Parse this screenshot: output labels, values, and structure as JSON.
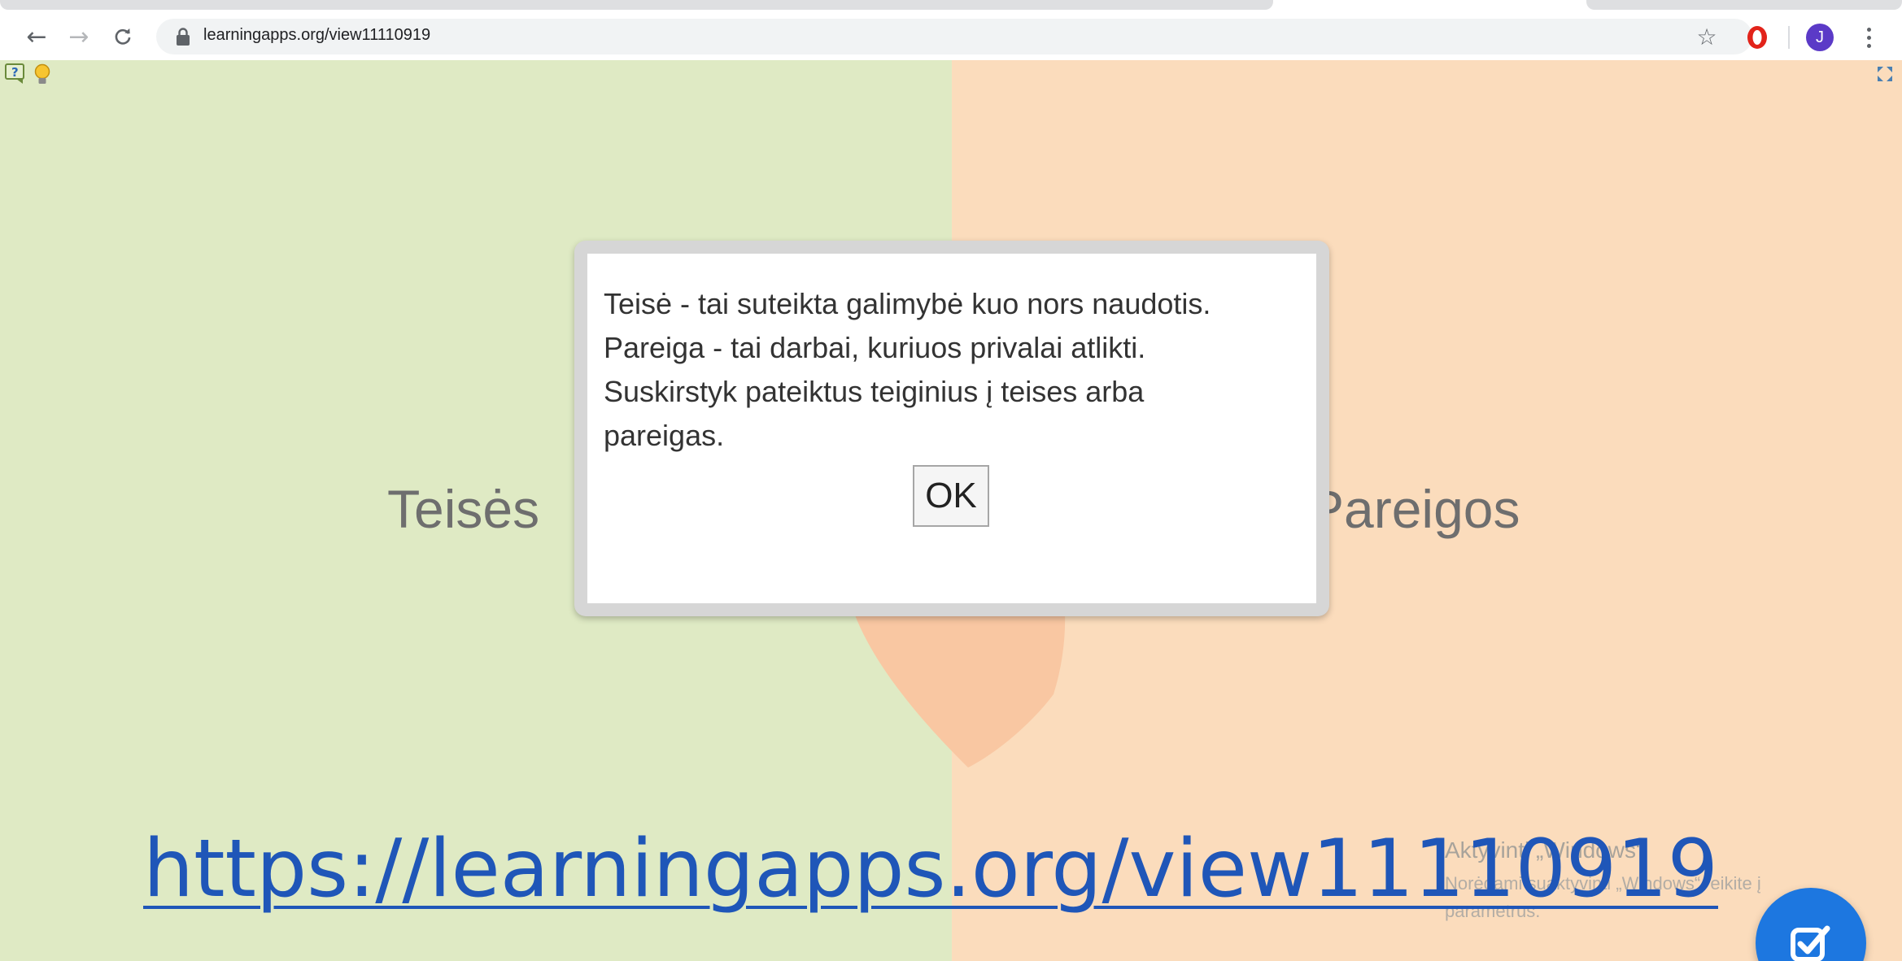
{
  "browser": {
    "url": "learningapps.org/view11110919",
    "back_glyph": "←",
    "forward_glyph": "→",
    "reload_glyph": "C",
    "star_glyph": "☆",
    "avatar_initial": "J",
    "icons": [
      "back-arrow-icon",
      "forward-arrow-icon",
      "reload-icon",
      "lock-icon",
      "star-icon",
      "opera-icon",
      "menu-icon"
    ]
  },
  "app": {
    "categories": {
      "left": "Teisės",
      "right": "Pareigos"
    },
    "colors": {
      "left_bg": "#dfeac4",
      "right_bg": "#fbdcbc",
      "blob": "#f9c7a2"
    },
    "icons": [
      "help-icon",
      "hint-lightbulb-icon",
      "fullscreen-icon"
    ]
  },
  "dialog": {
    "lines": [
      "Teisė - tai suteikta galimybė kuo nors naudotis.",
      "Pareiga - tai darbai, kuriuos privalai atlikti.",
      "Suskirstyk pateiktus teiginius į teises arba",
      "pareigas."
    ],
    "ok_label": "OK"
  },
  "overlay": {
    "link_text": "https://learningapps.org/view11110919",
    "watermark_title": "Aktyvinti „Windows“",
    "watermark_subtitle": "Norėdami suaktyvinti „Windows“, eikite į parametrus.",
    "check_button_icon": "check-icon",
    "accent": "#1d77e0"
  }
}
